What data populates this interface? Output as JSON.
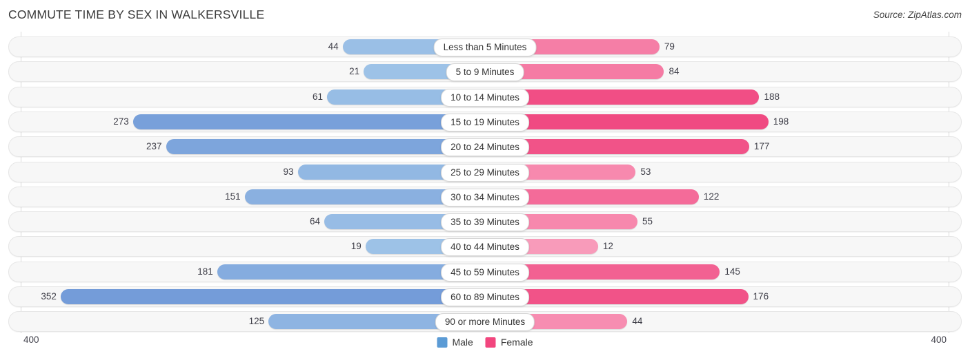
{
  "header": {
    "title": "COMMUTE TIME BY SEX IN WALKERSVILLE",
    "source": "Source: ZipAtlas.com"
  },
  "footer": {
    "axis_left": "400",
    "axis_right": "400"
  },
  "legend": {
    "items": [
      {
        "label": "Male",
        "color": "#5b9bd5"
      },
      {
        "label": "Female",
        "color": "#f2467e"
      }
    ]
  },
  "chart_data": {
    "type": "bar",
    "orientation": "horizontal-diverging",
    "title": "COMMUTE TIME BY SEX IN WALKERSVILLE",
    "xlabel": "",
    "ylabel": "",
    "xlim": [
      400,
      400
    ],
    "axis_max": 400,
    "grid": false,
    "legend_position": "bottom-center",
    "categories": [
      "Less than 5 Minutes",
      "5 to 9 Minutes",
      "10 to 14 Minutes",
      "15 to 19 Minutes",
      "20 to 24 Minutes",
      "25 to 29 Minutes",
      "30 to 34 Minutes",
      "35 to 39 Minutes",
      "40 to 44 Minutes",
      "45 to 59 Minutes",
      "60 to 89 Minutes",
      "90 or more Minutes"
    ],
    "series": [
      {
        "name": "Male",
        "side": "left",
        "values": [
          44,
          21,
          61,
          273,
          237,
          93,
          151,
          64,
          19,
          181,
          352,
          125
        ]
      },
      {
        "name": "Female",
        "side": "right",
        "values": [
          79,
          84,
          188,
          198,
          177,
          53,
          122,
          55,
          12,
          145,
          176,
          44
        ]
      }
    ]
  }
}
